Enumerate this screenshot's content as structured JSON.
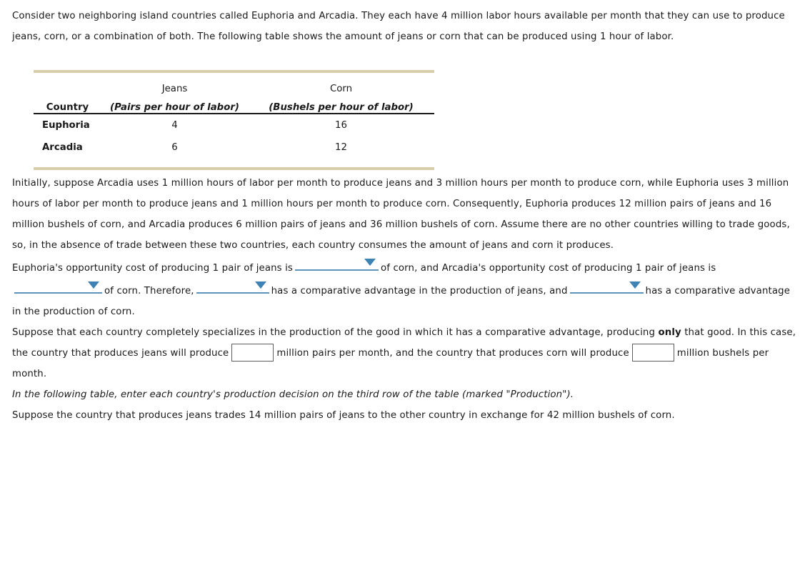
{
  "intro": {
    "text": "Consider two neighboring island countries called Euphoria and Arcadia. They each have 4 million labor hours available per month that they can use to produce jeans, corn, or a combination of both. The following table shows the amount of jeans or corn that can be produced using 1 hour of labor."
  },
  "table": {
    "header_top": {
      "country": "",
      "jeans": "Jeans",
      "corn": "Corn"
    },
    "header_bottom": {
      "country": "Country",
      "jeans_unit": "(Pairs per hour of labor)",
      "corn_unit": "(Bushels per hour of labor)"
    },
    "rows": [
      {
        "country": "Euphoria",
        "jeans": "4",
        "corn": "16"
      },
      {
        "country": "Arcadia",
        "jeans": "6",
        "corn": "12"
      }
    ],
    "border_color": "#d6ceaa",
    "header_rule_color": "#1a1a1a"
  },
  "initial_paragraph": {
    "text": "Initially, suppose Arcadia uses 1 million hours of labor per month to produce jeans and 3 million hours per month to produce corn, while Euphoria uses 3 million hours of labor per month to produce jeans and 1 million hours per month to produce corn. Consequently, Euphoria produces 12 million pairs of jeans and 16 million bushels of corn, and Arcadia produces 6 million pairs of jeans and 36 million bushels of corn. Assume there are no other countries willing to trade goods, so, in the absence of trade between these two countries, each country consumes the amount of jeans and corn it produces."
  },
  "opportunity_cost": {
    "segment1": "Euphoria's opportunity cost of producing 1 pair of jeans is",
    "dropdown1": {
      "value": "",
      "label": "euphoria-opportunity-cost-select"
    },
    "segment2": "of corn, and Arcadia's opportunity cost of producing 1 pair of jeans is",
    "dropdown2": {
      "value": "",
      "label": "arcadia-opportunity-cost-select"
    },
    "segment3": "of corn. Therefore,",
    "dropdown3": {
      "value": "",
      "label": "jeans-comparative-advantage-select"
    },
    "segment4": "has a comparative advantage in the production of jeans, and",
    "dropdown4": {
      "value": "",
      "label": "corn-comparative-advantage-select"
    },
    "segment5": "has a comparative advantage in the production of corn.",
    "accent_color": "#3f82b4",
    "underline_color": "#5c93bd"
  },
  "specialization": {
    "segment1": "Suppose that each country completely specializes in the production of the good in which it has a comparative advantage, producing",
    "emphasis": "only",
    "segment2": "that good. In this case, the country that produces jeans will produce",
    "input1": {
      "value": "",
      "placeholder": ""
    },
    "segment3": "million pairs per month, and the country that produces corn will produce",
    "input2": {
      "value": "",
      "placeholder": ""
    },
    "segment4": "million bushels per month."
  },
  "note": {
    "text": "In the following table, enter each country's production decision on the third row of the table (marked \"Production\")."
  },
  "trade": {
    "text": "Suppose the country that produces jeans trades 14 million pairs of jeans to the other country in exchange for 42 million bushels of corn."
  }
}
